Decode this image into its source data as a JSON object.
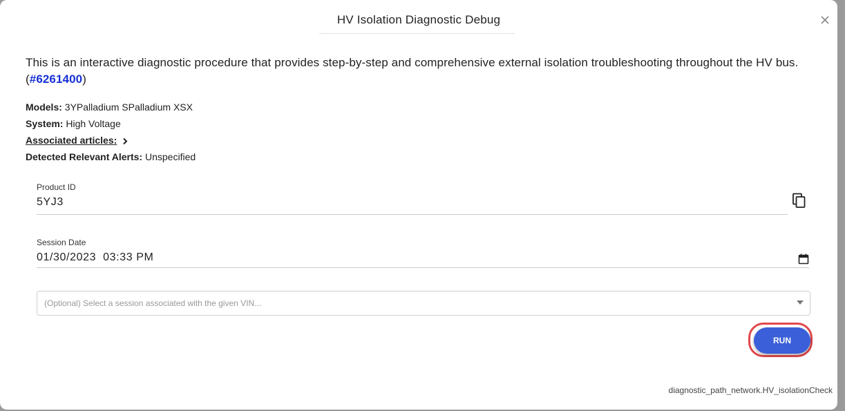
{
  "dialog": {
    "title": "HV Isolation Diagnostic Debug",
    "close_icon": "close-icon"
  },
  "description": {
    "text": "This is an interactive diagnostic procedure that provides step-by-step and comprehensive external isolation troubleshooting throughout the HV bus. (",
    "link_text": "#6261400",
    "suffix": ")"
  },
  "meta": {
    "models_label": "Models:",
    "models_value": "3YPalladium SPalladium XSX",
    "system_label": "System:",
    "system_value": "High Voltage",
    "associated_label": "Associated articles:",
    "alerts_label": "Detected Relevant Alerts:",
    "alerts_value": "Unspecified"
  },
  "product_id": {
    "label": "Product ID",
    "value": "5YJ3",
    "copy_icon": "copy-icon"
  },
  "session_date": {
    "label": "Session Date",
    "value": "01/30/2023  03:33 PM",
    "calendar_icon": "calendar-icon"
  },
  "session_select": {
    "placeholder": "(Optional) Select a session associated with the given VIN..."
  },
  "run_button": {
    "label": "RUN",
    "color": "#3b5fd9",
    "highlight_color": "#e0484c"
  },
  "footer": {
    "identifier": "diagnostic_path_network.HV_isolationCheck"
  },
  "colors": {
    "link": "#1730d6",
    "overlay": "#9a9a9a"
  }
}
